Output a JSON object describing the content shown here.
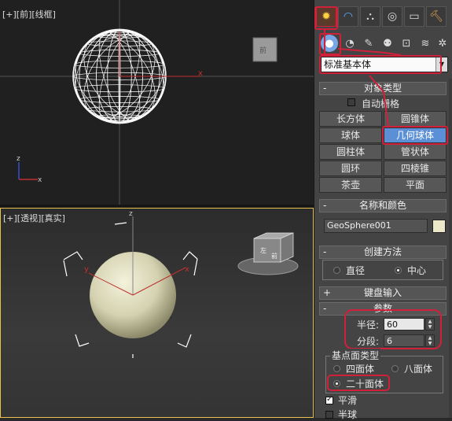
{
  "viewports": {
    "top": {
      "label": "[+][前][线框]"
    },
    "perspective": {
      "label": "[+][透视][真实]"
    },
    "viewcube_top_label": "前",
    "viewcube_persp_front": "前",
    "viewcube_persp_left": "左",
    "axis_x": "x",
    "axis_y": "y",
    "axis_z": "z"
  },
  "command_panel": {
    "tabs": [
      "create-icon",
      "modify-icon",
      "hierarchy-icon",
      "motion-icon",
      "display-icon",
      "utilities-icon"
    ],
    "subtabs": [
      "geometry-icon",
      "shapes-icon",
      "lights-icon",
      "cameras-icon",
      "helpers-icon",
      "spacewarps-icon",
      "systems-icon"
    ],
    "dropdown_value": "标准基本体",
    "object_type": {
      "title": "对象类型",
      "autogrid_label": "自动栅格",
      "buttons": [
        "长方体",
        "圆锥体",
        "球体",
        "几何球体",
        "圆柱体",
        "管状体",
        "圆环",
        "四棱锥",
        "茶壶",
        "平面"
      ],
      "active_button": "几何球体"
    },
    "name_color": {
      "title": "名称和颜色",
      "name": "GeoSphere001",
      "color": "#eae8c9"
    },
    "creation_method": {
      "title": "创建方法",
      "options": [
        "直径",
        "中心"
      ],
      "selected": "中心"
    },
    "keyboard": {
      "title": "键盘输入"
    },
    "parameters": {
      "title": "参数",
      "radius_label": "半径:",
      "radius_value": "60",
      "segments_label": "分段:",
      "segments_value": "6",
      "base_type_label": "基点面类型",
      "base_types": [
        "四面体",
        "八面体",
        "二十面体"
      ],
      "base_selected": "二十面体",
      "smooth_label": "平滑",
      "smooth_checked": true,
      "hemisphere_label": "半球"
    }
  },
  "colors": {
    "highlight": "#d0203a",
    "active_button": "#5b8fd6",
    "viewport_border": "#e8c24c"
  }
}
